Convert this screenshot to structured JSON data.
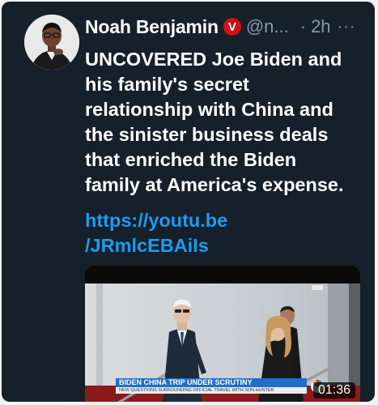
{
  "tweet": {
    "author": {
      "display_name": "Noah Benjamin",
      "verified_badge": "V",
      "handle": "@n...",
      "badge_color": "#d20f18"
    },
    "separator": "·",
    "timestamp": "2h",
    "more_icon": "···",
    "text_lines": [
      "UNCOVERED Joe Biden and",
      "his family's secret",
      "relationship with China and",
      "the sinister business deals",
      "that enriched the Biden",
      "family at America's expense."
    ],
    "link_lines": [
      "https://youtu.be",
      "/JRmlcEBAiIs"
    ],
    "link_color": "#1d9bf0",
    "media": {
      "chyron_title": "BIDEN CHINA TRIP UNDER SCRUTINY",
      "chyron_subtitle": "NEW QUESTIONS SURROUNDING OFFICIAL TRAVEL WITH SON HUNTER",
      "duration": "01:36",
      "icons": [
        "play-video-thumbnail",
        "nbc-peacock-logo"
      ]
    }
  },
  "colors": {
    "background": "#15202b",
    "text": "#ffffff",
    "muted": "#8899a6"
  }
}
